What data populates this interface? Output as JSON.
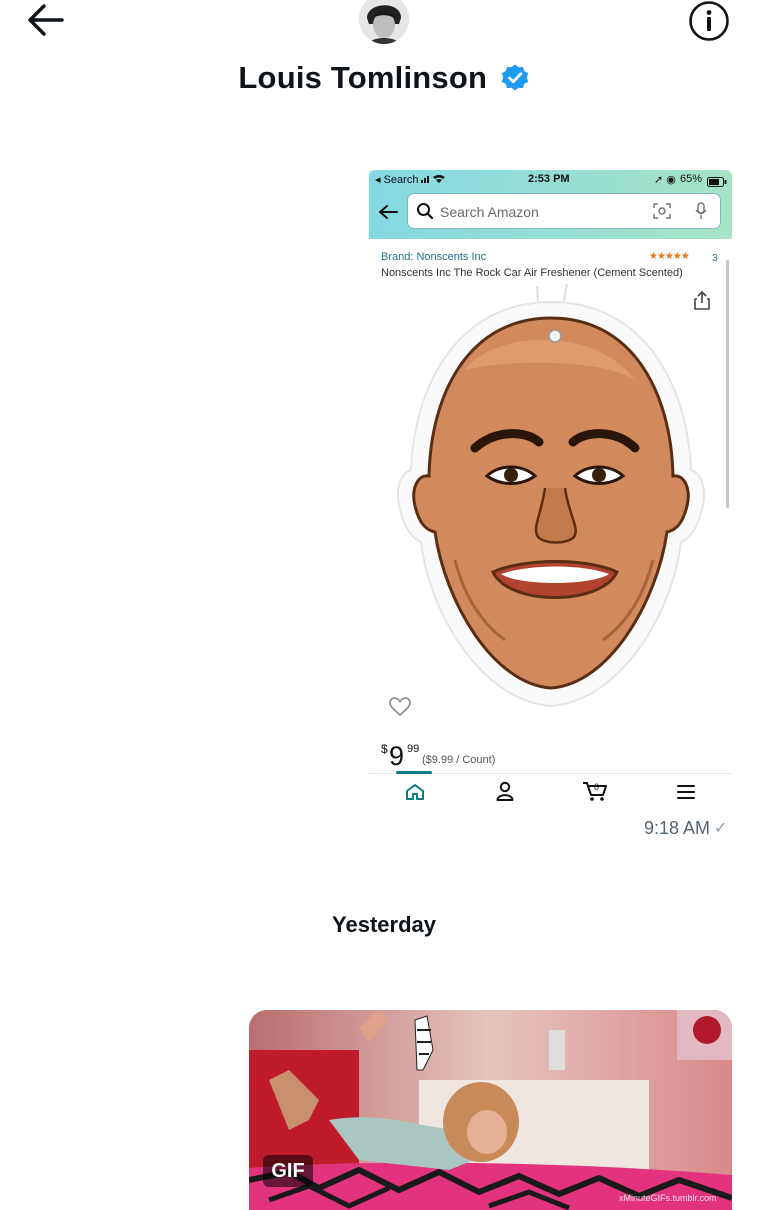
{
  "header": {
    "contact_name": "Louis Tomlinson",
    "verified": true,
    "icons": {
      "back": "arrow-left-icon",
      "info": "info-icon",
      "verified": "verified-badge-icon"
    }
  },
  "messages": [
    {
      "type": "image",
      "content": "amazon-product-screenshot",
      "time": "9:18 AM",
      "status": "sent-check-icon"
    },
    {
      "type": "gif",
      "badge": "GIF",
      "watermark": "xMinuteGIFs.tumblr.com"
    }
  ],
  "day_divider": "Yesterday",
  "amazon_screenshot": {
    "status_bar": {
      "back_label": "◂ Search",
      "time": "2:53 PM",
      "battery": "65%"
    },
    "search_placeholder": "Search Amazon",
    "brand": "Brand: Nonscents Inc",
    "rating_stars": "★★★★★",
    "rating_count": "3",
    "product_title": "Nonscents Inc The Rock Car Air Freshener (Cement Scented)",
    "price_symbol": "$",
    "price_whole": "9",
    "price_cents": "99",
    "price_per": "($9.99 / Count)",
    "bottom_nav": [
      "home-icon",
      "account-icon",
      "cart-icon",
      "menu-icon"
    ]
  },
  "colors": {
    "verified_blue": "#1d9bf0",
    "amazon_header_start": "#84d8e3",
    "amazon_header_end": "#a6e4c5",
    "amazon_teal": "#0d7b85",
    "timestamp_gray": "#536471"
  }
}
